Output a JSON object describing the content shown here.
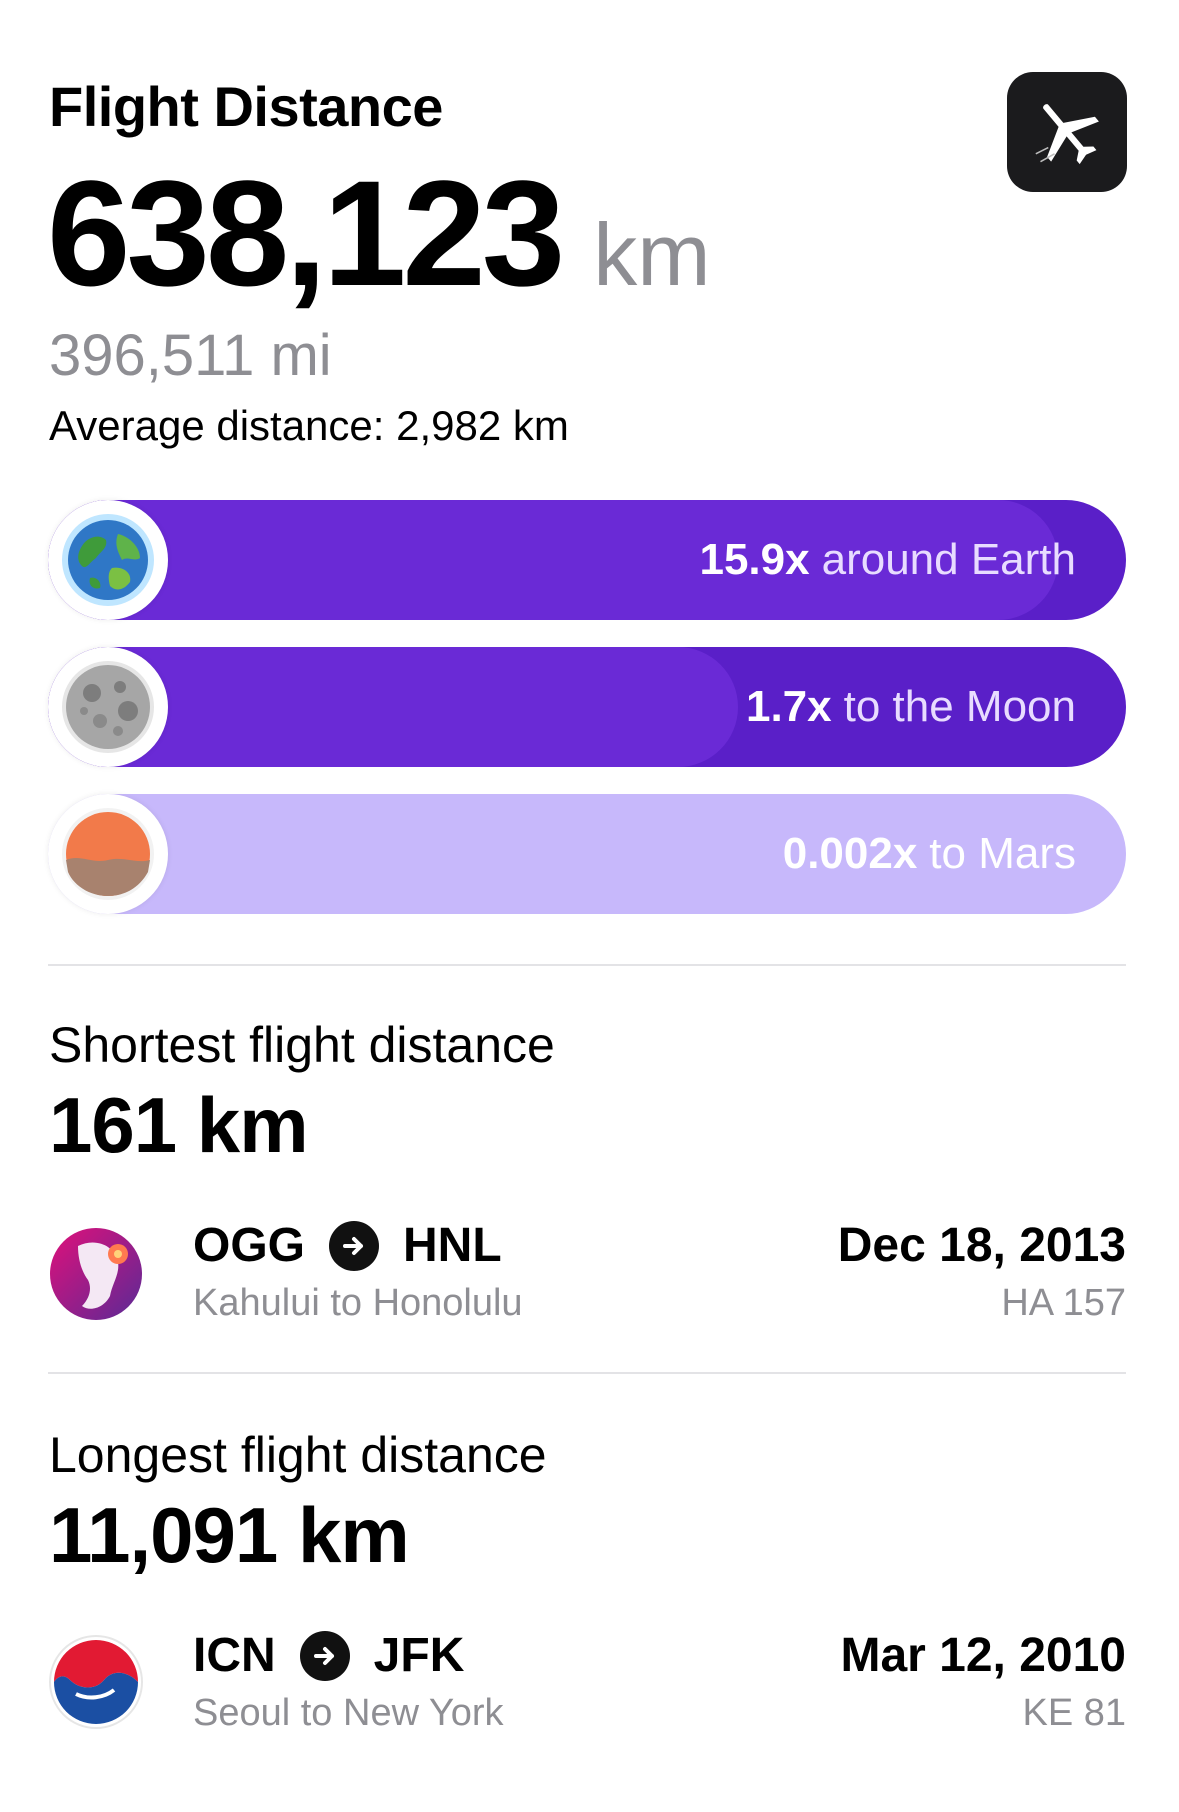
{
  "header": {
    "title": "Flight Distance",
    "total_value": "638,123",
    "total_unit": "km",
    "miles": "396,511 mi",
    "average": "Average distance: 2,982 km"
  },
  "comparisons": [
    {
      "icon": "earth-icon",
      "multiplier": "15.9x",
      "label": "around Earth",
      "fill_color": "#6a2ad6",
      "text_color": "#e8dcff",
      "track_color": "#5a1fc8",
      "fill_fraction": 1.0
    },
    {
      "icon": "moon-icon",
      "multiplier": "1.7x",
      "label": "to the Moon",
      "fill_color": "#6a2ad6",
      "text_color": "#e8dcff",
      "track_color": "#5a1fc8",
      "fill_fraction": 0.64
    },
    {
      "icon": "mars-icon",
      "multiplier": "0.002x",
      "label": "to Mars",
      "fill_color": "#c7b8fb",
      "text_color": "#ffffff",
      "track_color": "#c7b8fb",
      "fill_fraction": 0.0
    }
  ],
  "shortest": {
    "label": "Shortest flight distance",
    "value": "161 km",
    "airline_logo": "hawaiian-airlines-logo",
    "from": "OGG",
    "to": "HNL",
    "cities": "Kahului to Honolulu",
    "date": "Dec 18, 2013",
    "flight": "HA 157"
  },
  "longest": {
    "label": "Longest flight distance",
    "value": "11,091 km",
    "airline_logo": "korean-air-logo",
    "from": "ICN",
    "to": "JFK",
    "cities": "Seoul to New York",
    "date": "Mar 12, 2010",
    "flight": "KE 81"
  },
  "colors": {
    "accent_purple": "#6a2ad6",
    "light_purple": "#c7b8fb",
    "secondary_text": "#8e8e93"
  }
}
